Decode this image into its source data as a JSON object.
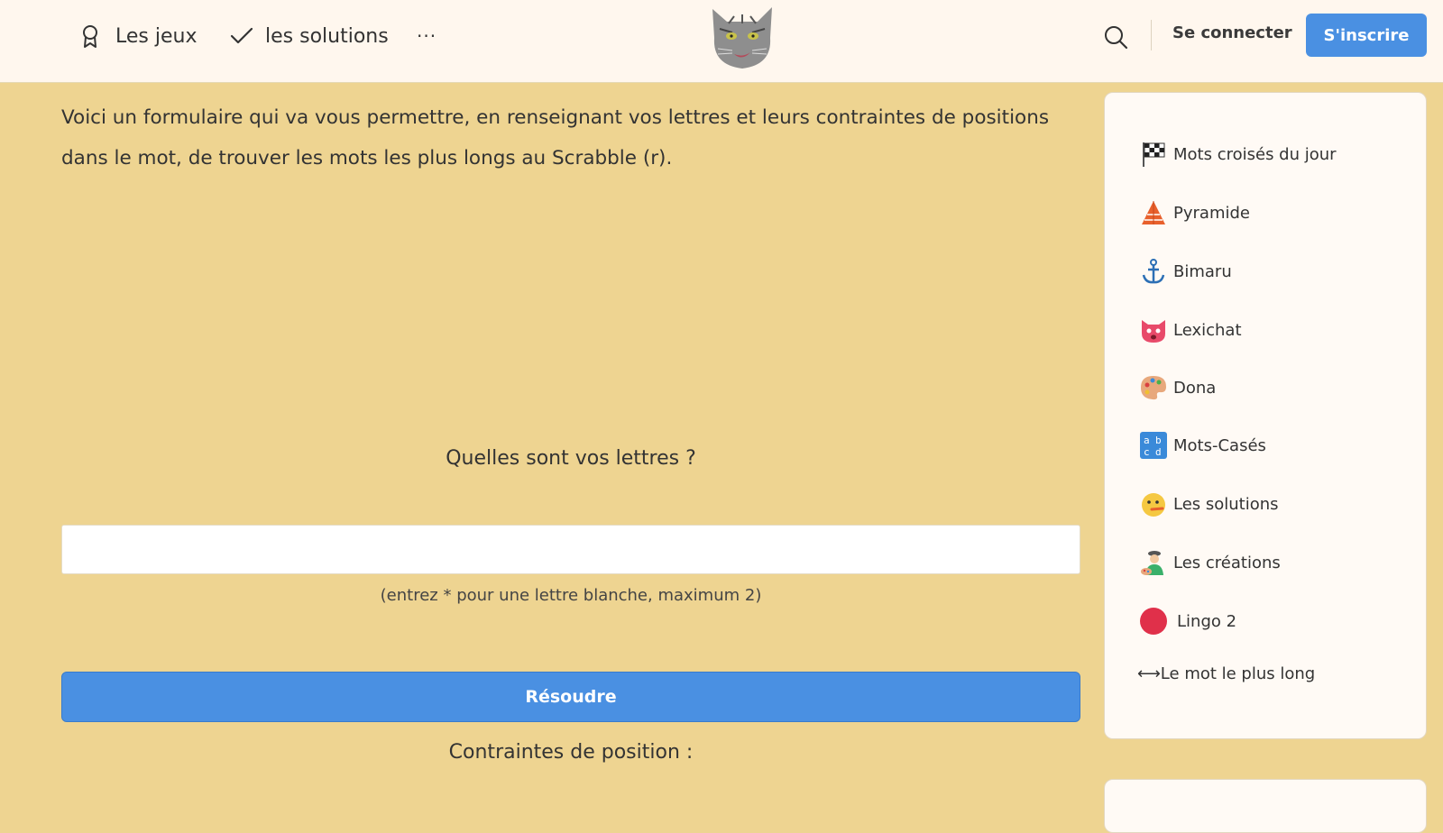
{
  "header": {
    "nav": [
      {
        "label": "Les jeux",
        "icon": "award-icon"
      },
      {
        "label": "les solutions",
        "icon": "check-icon"
      },
      {
        "label": "···",
        "icon": "more-icon"
      }
    ],
    "logo": "cat-logo",
    "login_label": "Se connecter",
    "signup_label": "S'inscrire",
    "accent_color": "#4a90e2"
  },
  "main": {
    "intro": "Voici un formulaire qui va vous permettre, en renseignant vos lettres et leurs contraintes de positions dans le mot, de trouver les mots les plus longs au Scrabble (r).",
    "letters_label": "Quelles sont vos lettres ?",
    "letters_value": "",
    "hint": "(entrez * pour une lettre blanche, maximum 2)",
    "solve_label": "Résoudre",
    "constraints_label": "Contraintes de position :"
  },
  "sidebar": {
    "items": [
      {
        "label": "Mots croisés du jour",
        "icon": "checkered-flag-icon"
      },
      {
        "label": "Pyramide",
        "icon": "pyramid-icon"
      },
      {
        "label": "Bimaru",
        "icon": "anchor-icon"
      },
      {
        "label": "Lexichat",
        "icon": "cat-face-icon"
      },
      {
        "label": "Dona",
        "icon": "palette-icon"
      },
      {
        "label": "Mots-Casés",
        "icon": "abcd-icon"
      },
      {
        "label": "Les solutions",
        "icon": "face-icon"
      },
      {
        "label": "Les créations",
        "icon": "artist-icon"
      },
      {
        "label": "Lingo 2",
        "icon": "red-circle-icon"
      },
      {
        "label": "⟷Le mot le plus long",
        "icon": ""
      }
    ]
  }
}
